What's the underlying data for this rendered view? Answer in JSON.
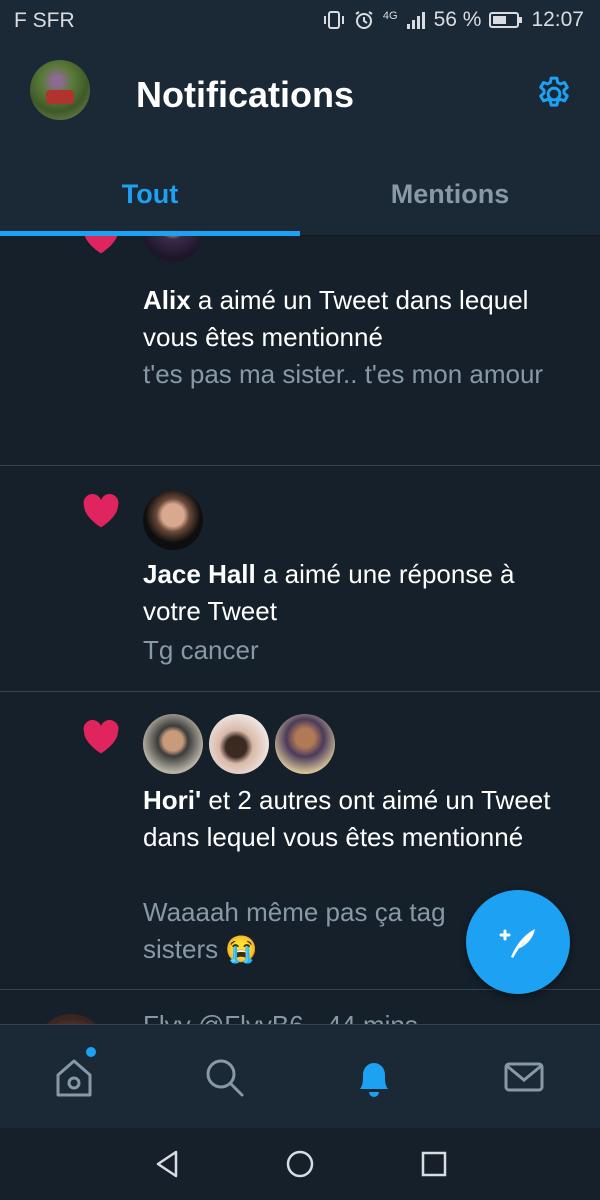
{
  "status_bar": {
    "carrier": "F SFR",
    "network": "4G",
    "battery_pct": "56 %",
    "time": "12:07"
  },
  "header": {
    "title": "Notifications",
    "avatar_icon": "user-avatar",
    "settings_icon": "gear-icon"
  },
  "tabs": [
    {
      "label": "Tout",
      "active": true
    },
    {
      "label": "Mentions",
      "active": false
    }
  ],
  "notifications": [
    {
      "type": "like",
      "user": "Alix",
      "action": " a aimé un Tweet dans lequel vous êtes mentionné",
      "tweet": "t'es pas ma sister.. t'es mon amour"
    },
    {
      "type": "like",
      "user": "Jace Hall",
      "action": " a aimé une réponse à votre Tweet",
      "tweet": "Tg cancer"
    },
    {
      "type": "like",
      "user": "Hori'",
      "action": " et 2 autres ont aimé un Tweet dans lequel vous êtes mentionné",
      "tweet": "Waaaah même pas ça tag",
      "tweet_tail": "sisters 😭"
    },
    {
      "type": "tweet",
      "partial_text": "Flyy @FlyyB6 · 44 mins"
    }
  ],
  "compose_button": {
    "icon": "compose-feather-icon"
  },
  "bottom_nav": [
    {
      "icon": "home-icon",
      "unread_dot": true
    },
    {
      "icon": "search-icon"
    },
    {
      "icon": "bell-icon",
      "active": true
    },
    {
      "icon": "mail-icon"
    }
  ],
  "system_nav": [
    "back-icon",
    "home-circle-icon",
    "recents-icon"
  ],
  "colors": {
    "accent": "#1da1f2",
    "like": "#e0245e",
    "background": "#15202b",
    "bar": "#1b2836",
    "secondary_text": "#8899a6"
  }
}
